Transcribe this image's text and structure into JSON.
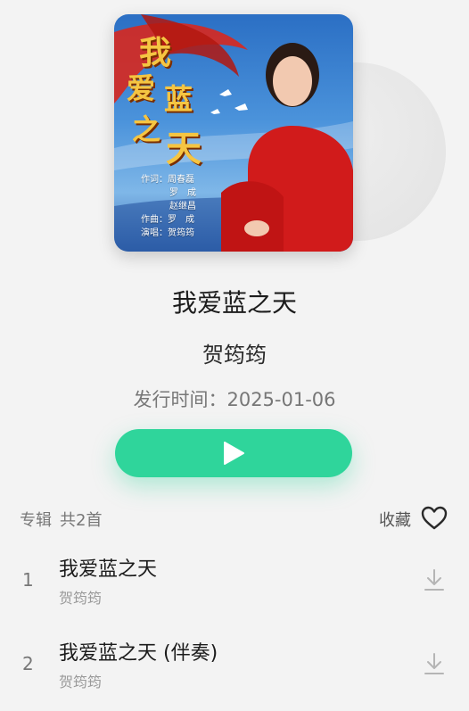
{
  "cover": {
    "title_chars": [
      "我",
      "爱",
      "蓝",
      "之",
      "天"
    ],
    "credits": [
      "作词：周春磊",
      "罗　成",
      "赵继昌",
      "作曲：罗　成",
      "演唱：贺筠筠"
    ]
  },
  "song": {
    "title": "我爱蓝之天",
    "artist": "贺筠筠",
    "release": "发行时间：2025-01-06"
  },
  "album": {
    "label": "专辑",
    "count": "共2首",
    "favorite_label": "收藏"
  },
  "tracks": [
    {
      "num": "1",
      "title": "我爱蓝之天",
      "artist": "贺筠筠"
    },
    {
      "num": "2",
      "title": "我爱蓝之天 (伴奏)",
      "artist": "贺筠筠"
    }
  ],
  "colors": {
    "accent": "#2fd59b",
    "background": "#f3f3f3"
  },
  "icons": [
    "play-icon",
    "heart-icon",
    "download-icon"
  ]
}
